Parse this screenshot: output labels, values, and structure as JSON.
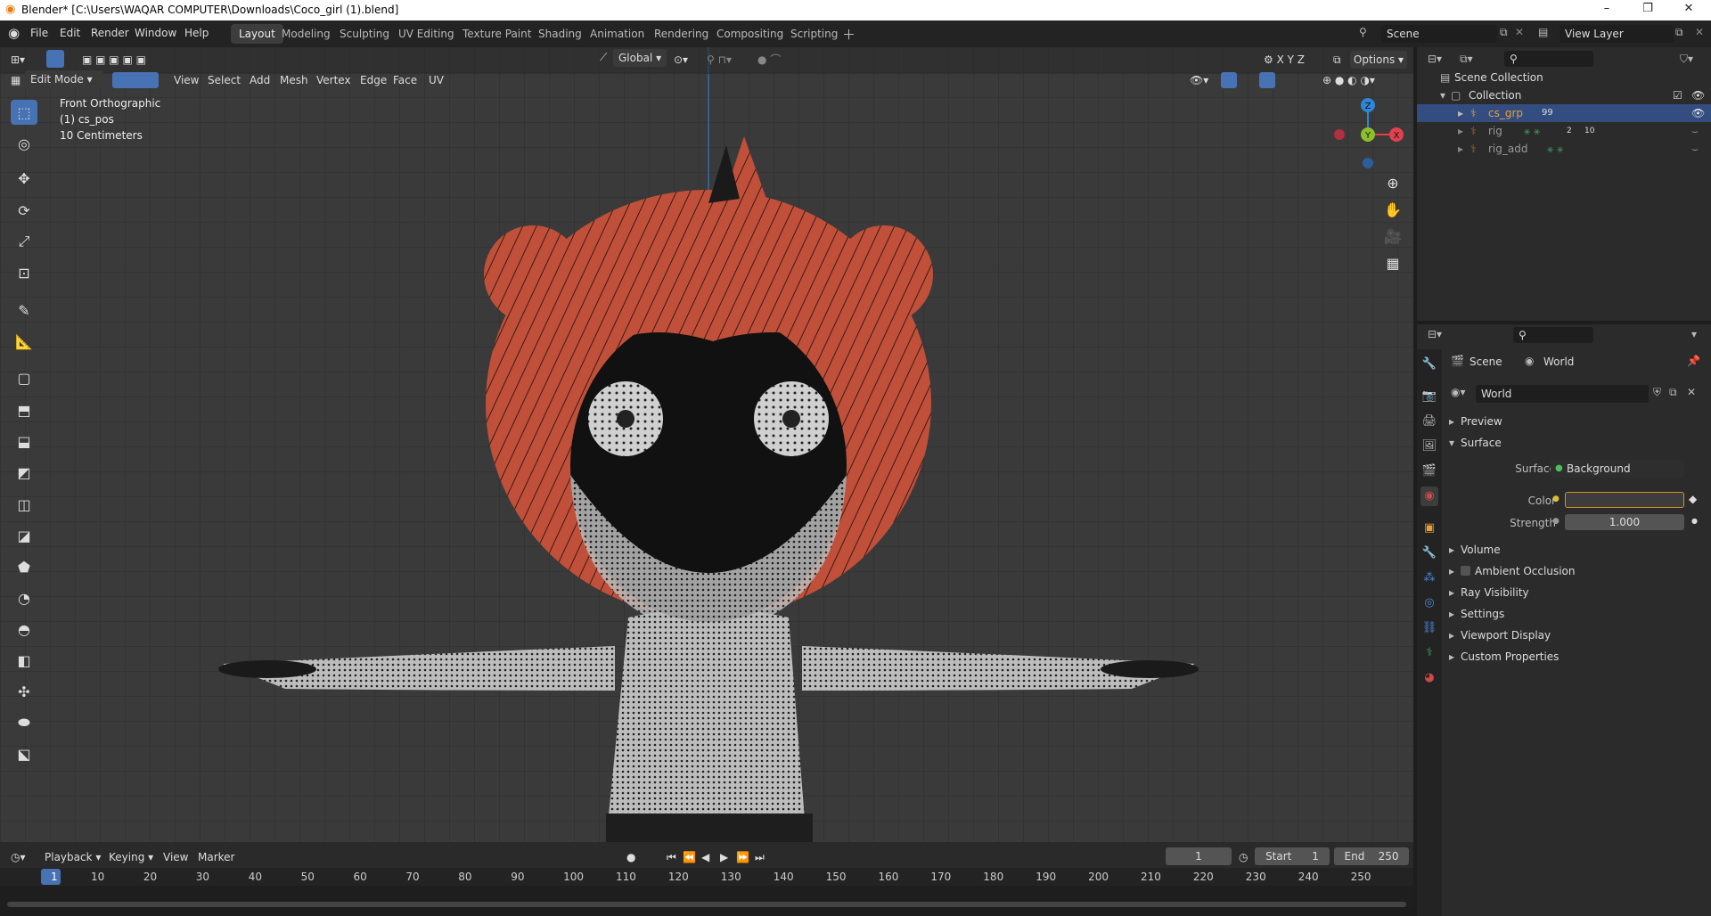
{
  "window": {
    "title": "Blender* [C:\\Users\\WAQAR COMPUTER\\Downloads\\Coco_girl (1).blend]",
    "controls": [
      "–",
      "❐",
      "✕"
    ]
  },
  "menu": [
    "File",
    "Edit",
    "Render",
    "Window",
    "Help"
  ],
  "workspaces": [
    "Layout",
    "Modeling",
    "Sculpting",
    "UV Editing",
    "Texture Paint",
    "Shading",
    "Animation",
    "Rendering",
    "Compositing",
    "Scripting"
  ],
  "active_workspace": "Layout",
  "scene_name": "Scene",
  "view_layer": "View Layer",
  "viewport": {
    "mode": "Edit Mode",
    "menus": [
      "View",
      "Select",
      "Add",
      "Mesh",
      "Vertex",
      "Edge",
      "Face",
      "UV"
    ],
    "transform_orientation": "Global",
    "options_label": "Options",
    "overlay_lines": [
      "Front Orthographic",
      "(1) cs_pos",
      "10 Centimeters"
    ],
    "axis_labels": {
      "z": "Z",
      "y": "Y",
      "x": "X"
    },
    "axis_colors": {
      "x": "#e0414f",
      "y": "#8cbf2b",
      "z": "#2e86d8"
    }
  },
  "outliner": {
    "root": "Scene Collection",
    "collection": "Collection",
    "items": [
      {
        "name": "cs_grp",
        "badge": "99",
        "selected": true
      },
      {
        "name": "rig",
        "badge": "10",
        "badge2": "2",
        "selected": false
      },
      {
        "name": "rig_add",
        "selected": false
      }
    ]
  },
  "properties": {
    "breadcrumb": [
      "Scene",
      "World"
    ],
    "world_name": "World",
    "sections": [
      "Preview",
      "Surface",
      "Volume",
      "Ambient Occlusion",
      "Ray Visibility",
      "Settings",
      "Viewport Display",
      "Custom Properties"
    ],
    "surface_label": "Surface",
    "surface_value": "Background",
    "color_label": "Color",
    "strength_label": "Strength",
    "strength_value": "1.000"
  },
  "timeline": {
    "menus": [
      "Playback",
      "Keying",
      "View",
      "Marker"
    ],
    "current_frame": "1",
    "start_label": "Start",
    "start_value": "1",
    "end_label": "End",
    "end_value": "250",
    "ticks": [
      "1",
      "10",
      "20",
      "30",
      "40",
      "50",
      "60",
      "70",
      "80",
      "90",
      "100",
      "110",
      "120",
      "130",
      "140",
      "150",
      "160",
      "170",
      "180",
      "190",
      "200",
      "210",
      "220",
      "230",
      "240",
      "250"
    ]
  },
  "colors": {
    "accent": "#4772b3",
    "hair": "#c0503a",
    "active_frame": "#4772b3"
  }
}
